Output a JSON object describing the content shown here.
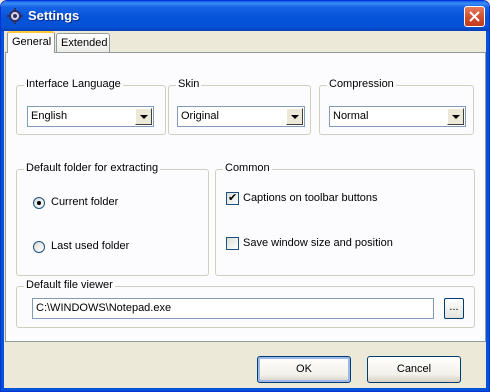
{
  "window": {
    "title": "Settings",
    "app_icon": "gear-icon",
    "close_icon": "close-x-icon"
  },
  "tabs": [
    {
      "label": "General",
      "active": true
    },
    {
      "label": "Extended",
      "active": false
    }
  ],
  "groups": {
    "interface_language": {
      "legend": "Interface Language",
      "value": "English"
    },
    "skin": {
      "legend": "Skin",
      "value": "Original"
    },
    "compression": {
      "legend": "Compression",
      "value": "Normal"
    },
    "default_folder": {
      "legend": "Default folder for extracting",
      "options": [
        {
          "label": "Current folder",
          "selected": true
        },
        {
          "label": "Last used folder",
          "selected": false
        }
      ]
    },
    "common": {
      "legend": "Common",
      "options": [
        {
          "label": "Captions on toolbar buttons",
          "checked": true
        },
        {
          "label": "Save window size and position",
          "checked": false
        }
      ]
    },
    "default_viewer": {
      "legend": "Default file viewer",
      "value": "C:\\WINDOWS\\Notepad.exe",
      "browse_label": "..."
    }
  },
  "buttons": {
    "ok": "OK",
    "cancel": "Cancel"
  }
}
